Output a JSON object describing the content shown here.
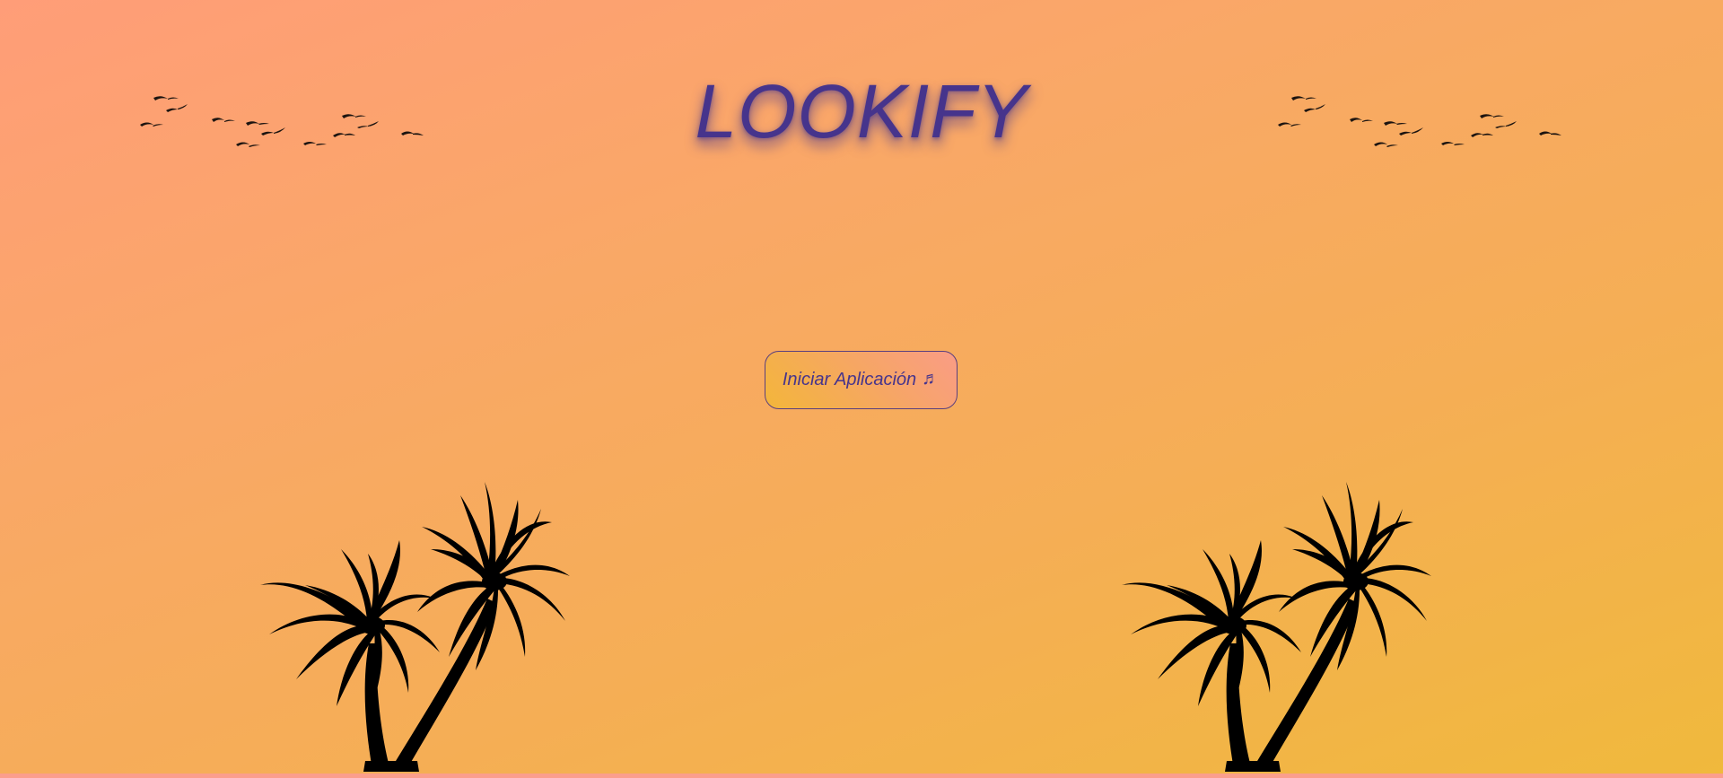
{
  "app": {
    "title": "LOOKIFY"
  },
  "actions": {
    "start_label": "Iniciar Aplicación",
    "start_icon_glyph": "♬",
    "start_icon": "music-notes-icon"
  },
  "decorations": {
    "birds": "birds-flock-icon",
    "palms": "palm-trees-icon"
  },
  "colors": {
    "title": "#46348c",
    "background_top_left": "#ff9d78",
    "background_bottom_right": "#f0b93c",
    "button_border": "#5a3f7e"
  }
}
